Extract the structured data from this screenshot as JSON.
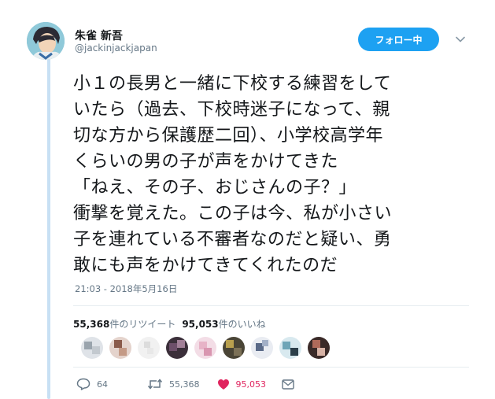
{
  "user": {
    "display_name": "朱雀 新吾",
    "handle": "@jackinjackjapan",
    "follow_label": "フォロー中"
  },
  "tweet": {
    "lines": [
      "小１の長男と一緒に下校する練習をして",
      "いたら（過去、下校時迷子になって、親",
      "切な方から保護歴二回）、小学校高学年",
      "くらいの男の子が声をかけてきた",
      "「ねえ、その子、おじさんの子？」",
      "衝撃を覚えた。この子は今、私が小さい",
      "子を連れている不審者なのだと疑い、勇",
      "敢にも声をかけてきてくれたのだ"
    ],
    "timestamp": "21:03 - 2018年5月16日"
  },
  "stats": {
    "retweets_count": "55,368",
    "retweets_label": "件のリツイート",
    "likes_count": "95,053",
    "likes_label": "件のいいね"
  },
  "likers_count": 9,
  "actions": {
    "reply_count": "64",
    "retweet_count": "55,368",
    "like_count": "95,053"
  },
  "colors": {
    "accent": "#1da1f2",
    "like": "#e0245e",
    "muted": "#657786",
    "thread": "#c8e0f4"
  }
}
